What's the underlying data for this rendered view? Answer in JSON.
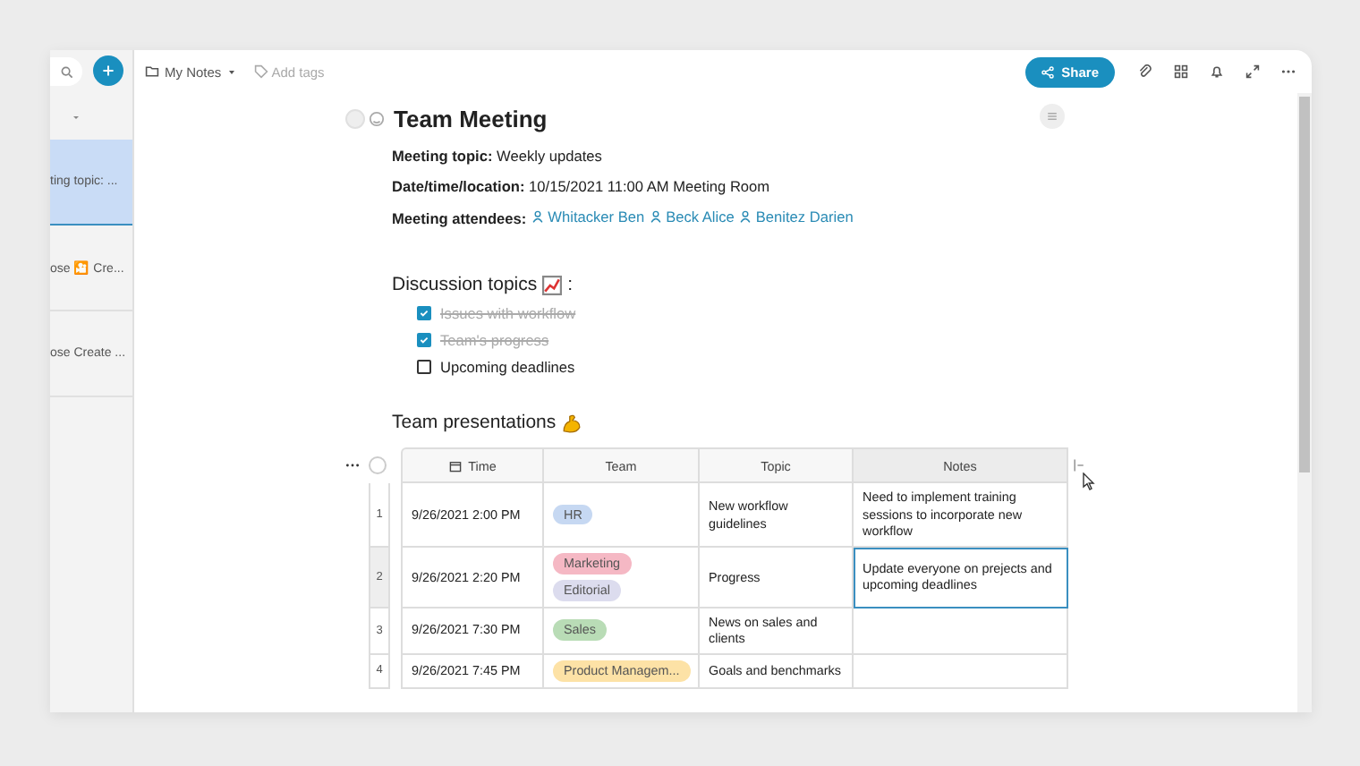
{
  "sidebar": {
    "items": [
      {
        "text": "ting topic: ...",
        "selected": true
      },
      {
        "text": "ose 🎦 Cre...",
        "selected": false
      },
      {
        "text": "ose Create ...",
        "selected": false
      }
    ]
  },
  "toolbar": {
    "folder": "My Notes",
    "tags_placeholder": "Add tags",
    "share": "Share"
  },
  "note": {
    "title": "Team Meeting",
    "fields": [
      {
        "kind": "text",
        "label": "Meeting topic:",
        "value": "Weekly updates"
      },
      {
        "kind": "text",
        "label": "Date/time/location:",
        "value": "10/15/2021 11:00 AM Meeting Room"
      },
      {
        "kind": "people",
        "label": "Meeting attendees:",
        "people": [
          "Whitacker Ben",
          "Beck Alice",
          "Benitez Darien"
        ]
      }
    ],
    "discussion": {
      "heading": "Discussion topics",
      "suffix": ":",
      "items": [
        {
          "text": "Issues with workflow",
          "checked": true
        },
        {
          "text": "Team's progress",
          "checked": true
        },
        {
          "text": "Upcoming deadlines",
          "checked": false
        }
      ]
    },
    "presentations": {
      "heading": "Team presentations",
      "table": {
        "columns": [
          "Time",
          "Team",
          "Topic",
          "Notes"
        ],
        "rows": [
          {
            "number": "1",
            "time": "9/26/2021 2:00 PM",
            "teams": [
              {
                "label": "HR",
                "color": "#c6d8f2"
              }
            ],
            "topic": "New workflow guidelines",
            "notes": "Need to implement training sessions to incorporate new workflow",
            "selected": false
          },
          {
            "number": "2",
            "time": "9/26/2021 2:20 PM",
            "teams": [
              {
                "label": "Marketing",
                "color": "#f5b8c4"
              },
              {
                "label": "Editorial",
                "color": "#dcdcee"
              }
            ],
            "topic": "Progress",
            "notes": "Update everyone on prejects and upcoming deadlines",
            "selected": true
          },
          {
            "number": "3",
            "time": "9/26/2021 7:30 PM",
            "teams": [
              {
                "label": "Sales",
                "color": "#b9dcb6"
              }
            ],
            "topic": "News on sales and clients",
            "notes": "",
            "selected": false
          },
          {
            "number": "4",
            "time": "9/26/2021 7:45 PM",
            "teams": [
              {
                "label": "Product Managem...",
                "color": "#fde2a6"
              }
            ],
            "topic": "Goals and benchmarks",
            "notes": "",
            "selected": false
          }
        ]
      }
    }
  }
}
